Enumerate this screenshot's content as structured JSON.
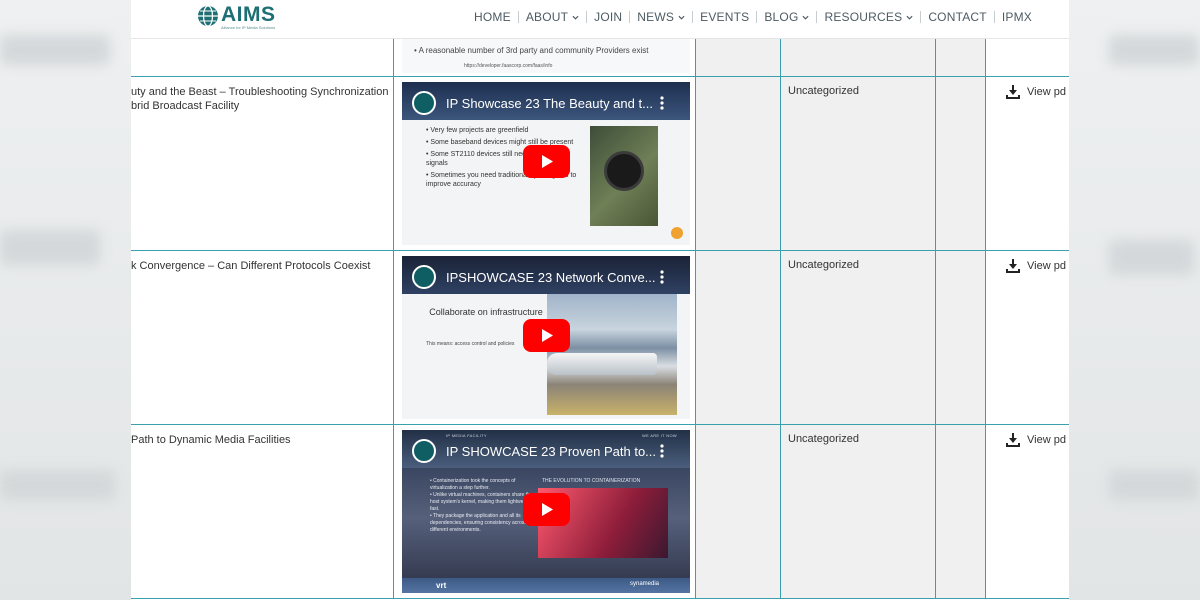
{
  "header": {
    "logo_text": "AIMS",
    "logo_subtitle": "Alliance for IP Media Solutions",
    "nav": [
      {
        "label": "HOME",
        "dropdown": false
      },
      {
        "label": "ABOUT",
        "dropdown": true
      },
      {
        "label": "JOIN",
        "dropdown": false
      },
      {
        "label": "NEWS",
        "dropdown": true
      },
      {
        "label": "EVENTS",
        "dropdown": false
      },
      {
        "label": "BLOG",
        "dropdown": true
      },
      {
        "label": "RESOURCES",
        "dropdown": true
      },
      {
        "label": "CONTACT",
        "dropdown": false
      },
      {
        "label": "IPMX",
        "dropdown": false
      }
    ]
  },
  "top_partial": {
    "bullet": "• A reasonable number of 3rd party and community Providers exist",
    "url": "https://developer.faascorp.com/faas/info"
  },
  "rows": [
    {
      "title": "uty and the Beast – Troubleshooting Synchronization",
      "title2": "brid Broadcast Facility",
      "video_title": "IP Showcase 23 The Beauty and t...",
      "slide_bullets": [
        "• Very few projects are greenfield",
        "• Some baseband devices might still be present",
        "• Some ST2110 devices still need analog sync signals",
        "• Sometimes you need traditional sync signals to improve accuracy"
      ],
      "category": "Uncategorized",
      "pdf_label": "View pd"
    },
    {
      "title": "k Convergence – Can Different Protocols Coexist",
      "video_title": "IPSHOWCASE 23 Network Conve...",
      "slide_heading": "Collaborate on infrastructure",
      "slide_sub": "This means: access control and policies",
      "category": "Uncategorized",
      "pdf_label": "View pd"
    },
    {
      "title": "Path to Dynamic Media Facilities",
      "video_title": "IP SHOWCASE 23 Proven Path to...",
      "top_left_label": "IP MEDIA FACILITY",
      "top_right_label": "WE ARE IT NOW",
      "slide_heading": "THE EVOLUTION TO CONTAINERIZATION",
      "slide_bullets": [
        "• Containerization took the concepts of virtualization a step further.",
        "• Unlike virtual machines, containers share the host system's kernel, making them lightweight and fast.",
        "• They package the application and all its dependencies, ensuring consistency across different environments."
      ],
      "brand_left": "vrt",
      "brand_right": "synamedia",
      "category": "Uncategorized",
      "pdf_label": "View pd"
    }
  ],
  "colors": {
    "brand_teal": "#1e6f74",
    "grid_line": "#3aa0ab",
    "youtube_red": "#ff0000"
  }
}
